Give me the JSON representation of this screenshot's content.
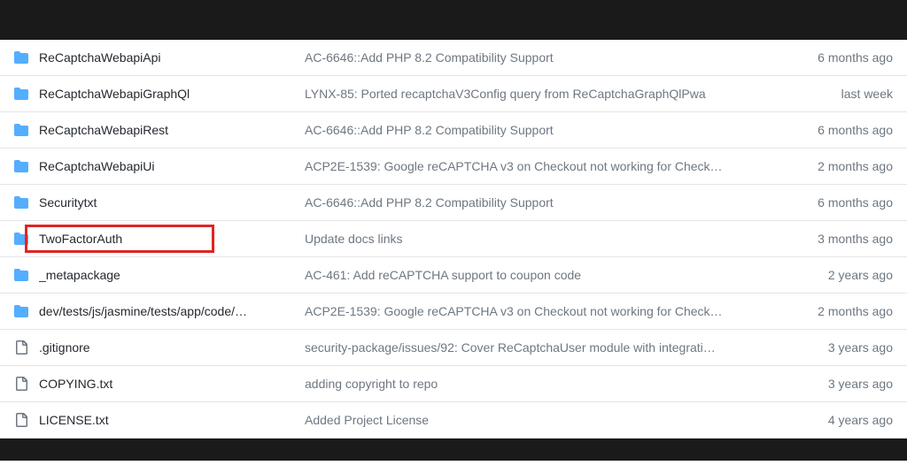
{
  "rows": [
    {
      "type": "folder",
      "name": "ReCaptchaWebapiApi",
      "message": "AC-6646::Add PHP 8.2 Compatibility Support",
      "age": "6 months ago",
      "highlight": false
    },
    {
      "type": "folder",
      "name": "ReCaptchaWebapiGraphQl",
      "message": "LYNX-85: Ported recaptchaV3Config query from ReCaptchaGraphQlPwa",
      "age": "last week",
      "highlight": false
    },
    {
      "type": "folder",
      "name": "ReCaptchaWebapiRest",
      "message": "AC-6646::Add PHP 8.2 Compatibility Support",
      "age": "6 months ago",
      "highlight": false
    },
    {
      "type": "folder",
      "name": "ReCaptchaWebapiUi",
      "message": "ACP2E-1539: Google reCAPTCHA v3 on Checkout not working for Check…",
      "age": "2 months ago",
      "highlight": false
    },
    {
      "type": "folder",
      "name": "Securitytxt",
      "message": "AC-6646::Add PHP 8.2 Compatibility Support",
      "age": "6 months ago",
      "highlight": false
    },
    {
      "type": "folder",
      "name": "TwoFactorAuth",
      "message": "Update docs links",
      "age": "3 months ago",
      "highlight": true
    },
    {
      "type": "folder",
      "name": "_metapackage",
      "message": "AC-461: Add reCAPTCHA support to coupon code",
      "age": "2 years ago",
      "highlight": false
    },
    {
      "type": "folder",
      "name": "dev/tests/js/jasmine/tests/app/code/…",
      "message": "ACP2E-1539: Google reCAPTCHA v3 on Checkout not working for Check…",
      "age": "2 months ago",
      "highlight": false
    },
    {
      "type": "file",
      "name": ".gitignore",
      "message": "security-package/issues/92: Cover ReCaptchaUser module with integrati…",
      "age": "3 years ago",
      "highlight": false
    },
    {
      "type": "file",
      "name": "COPYING.txt",
      "message": "adding copyright to repo",
      "age": "3 years ago",
      "highlight": false
    },
    {
      "type": "file",
      "name": "LICENSE.txt",
      "message": "Added Project License",
      "age": "4 years ago",
      "highlight": false
    }
  ]
}
